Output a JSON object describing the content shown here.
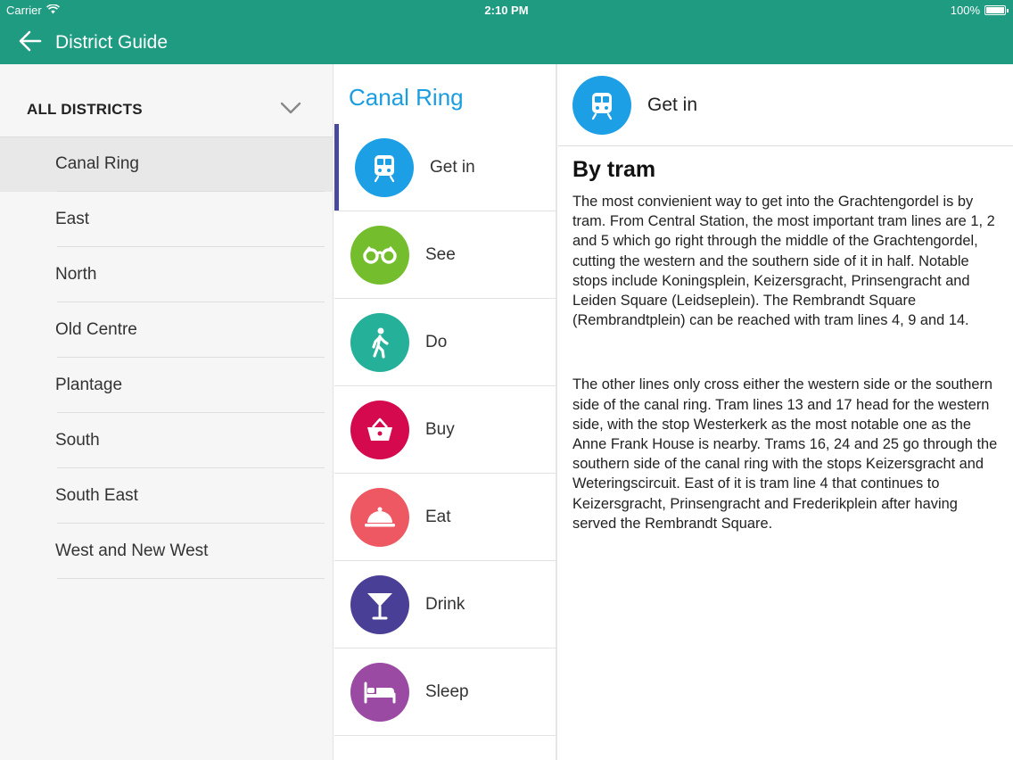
{
  "status_bar": {
    "carrier": "Carrier",
    "time": "2:10 PM",
    "battery": "100%"
  },
  "nav": {
    "title": "District Guide",
    "back_icon": "arrow-left-icon"
  },
  "sidebar": {
    "dropdown_label": "ALL DISTRICTS",
    "items": [
      {
        "label": "Canal Ring",
        "selected": true
      },
      {
        "label": "East"
      },
      {
        "label": "North"
      },
      {
        "label": "Old Centre"
      },
      {
        "label": "Plantage"
      },
      {
        "label": "South"
      },
      {
        "label": "South East"
      },
      {
        "label": "West and New West"
      }
    ]
  },
  "district": {
    "title": "Canal Ring",
    "title_color": "#1a9de1",
    "categories": [
      {
        "label": "Get in",
        "icon": "train-icon",
        "color": "#1d9fe6",
        "selected": true
      },
      {
        "label": "See",
        "icon": "binoculars-icon",
        "color": "#74be2d"
      },
      {
        "label": "Do",
        "icon": "walking-person-icon",
        "color": "#25b09a"
      },
      {
        "label": "Buy",
        "icon": "shopping-basket-icon",
        "color": "#d4094e"
      },
      {
        "label": "Eat",
        "icon": "cloche-icon",
        "color": "#ee5863"
      },
      {
        "label": "Drink",
        "icon": "cocktail-glass-icon",
        "color": "#4a3f97"
      },
      {
        "label": "Sleep",
        "icon": "bed-icon",
        "color": "#9a4aa2"
      }
    ]
  },
  "detail": {
    "header": "Get in",
    "header_icon": "train-icon",
    "section_title": "By tram",
    "paragraphs": [
      "The most convienient way to get into the Grachtengordel is by tram. From Central Station, the most important tram lines are 1, 2 and 5 which go right through the middle of the Grachtengordel, cutting the western and the southern side of it in half. Notable stops include Koningsplein, Keizersgracht, Prinsengracht and Leiden Square (Leidseplein). The Rembrandt Square (Rembrandtplein) can be reached with tram lines 4, 9 and 14.",
      "The other lines only cross either the western side or the southern side of the canal ring. Tram lines 13 and 17 head for the western side, with the stop Westerkerk as the most notable one as the Anne Frank House is nearby. Trams 16, 24 and 25 go through the southern side of the canal ring with the stops Keizersgracht and Weteringscircuit. East of it is tram line 4 that continues to Keizersgracht, Prinsengracht and Frederikplein after having served the Rembrandt Square."
    ]
  },
  "colors": {
    "header_bar": "#1f9b82",
    "selected_indicator": "#4a4a9c"
  }
}
